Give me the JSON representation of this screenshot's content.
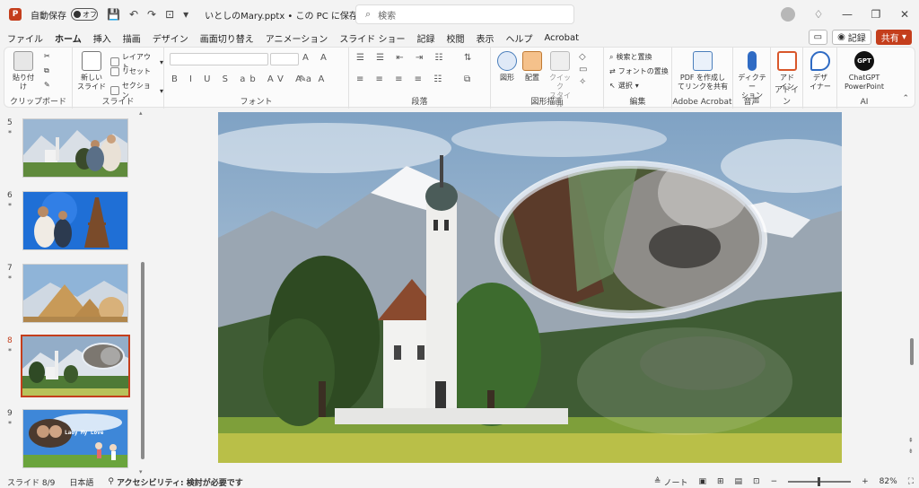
{
  "titlebar": {
    "app_logo": "P",
    "autosave_label": "自動保存",
    "autosave_state": "オフ",
    "filename": "いとしのMary.pptx • この PC に保存済み ∨",
    "search_placeholder": "検索"
  },
  "menu": {
    "tabs": [
      "ファイル",
      "ホーム",
      "挿入",
      "描画",
      "デザイン",
      "画面切り替え",
      "アニメーション",
      "スライド ショー",
      "記録",
      "校閲",
      "表示",
      "ヘルプ",
      "Acrobat"
    ],
    "active_tab": "ホーム",
    "record_label": "記録",
    "share_label": "共有"
  },
  "ribbon": {
    "clipboard": {
      "paste": "貼り付け",
      "label": "クリップボード"
    },
    "slides": {
      "new_slide": "新しい\nスライド",
      "layout": "レイアウト",
      "reset": "リセット",
      "section": "セクション",
      "label": "スライド"
    },
    "font": {
      "label": "フォント"
    },
    "paragraph": {
      "label": "段落"
    },
    "drawing": {
      "shapes": "図形",
      "arrange": "配置",
      "quick_styles": "クイック\nスタイル",
      "label": "図形描画"
    },
    "editing": {
      "find_replace": "検索と置換",
      "replace_font": "フォントの置換",
      "select": "選択",
      "label": "編集"
    },
    "acrobat": {
      "pdf": "PDF を作成し\nてリンクを共有",
      "label": "Adobe Acrobat"
    },
    "voice": {
      "dictate": "ディクテー\nション",
      "label": "音声"
    },
    "addins": {
      "addin": "アド\nイン",
      "label": "アドイン"
    },
    "designer": {
      "designer": "デザ\nイナー"
    },
    "ai": {
      "chatgpt": "ChatGPT\nPowerPoint",
      "badge": "GPT",
      "label": "AI"
    }
  },
  "slides": [
    {
      "number": "5",
      "star": "*"
    },
    {
      "number": "6",
      "star": "*"
    },
    {
      "number": "7",
      "star": "*"
    },
    {
      "number": "8",
      "star": "*"
    },
    {
      "number": "9",
      "star": "*"
    }
  ],
  "thumb9_caption": "Lady My Love",
  "status": {
    "slide": "スライド 8/9",
    "language": "日本語",
    "accessibility": "アクセシビリティ: 検討が必要です",
    "notes": "ノート",
    "zoom": "82%"
  }
}
